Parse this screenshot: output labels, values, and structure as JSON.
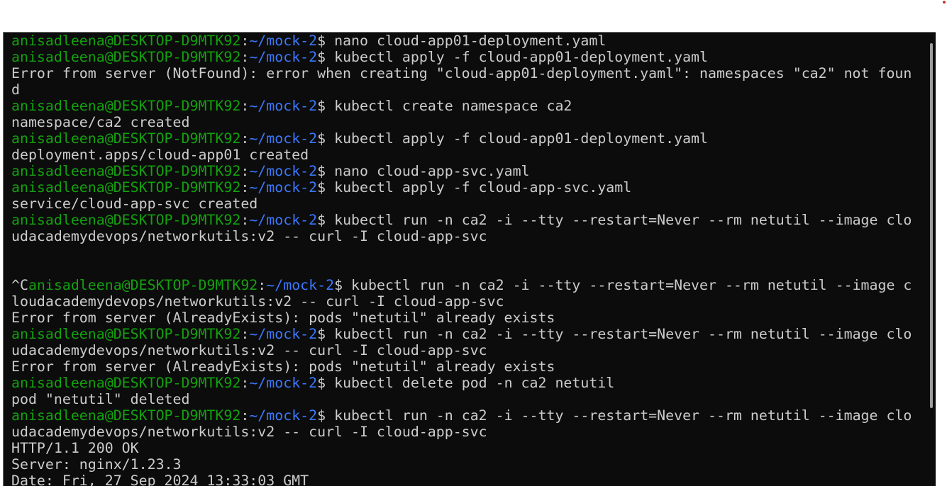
{
  "colors": {
    "background": "#0c0c0c",
    "text": "#cccccc",
    "user": "#13a10e",
    "path": "#3b78ff"
  },
  "terminal": {
    "lines": [
      {
        "parts": [
          {
            "cls": "user",
            "t": "anisadleena@DESKTOP-D9MTK92"
          },
          {
            "cls": "",
            "t": ":"
          },
          {
            "cls": "path",
            "t": "~/mock-2"
          },
          {
            "cls": "",
            "t": "$ nano cloud-app01-deployment.yaml"
          }
        ]
      },
      {
        "parts": [
          {
            "cls": "user",
            "t": "anisadleena@DESKTOP-D9MTK92"
          },
          {
            "cls": "",
            "t": ":"
          },
          {
            "cls": "path",
            "t": "~/mock-2"
          },
          {
            "cls": "",
            "t": "$ kubectl apply -f cloud-app01-deployment.yaml"
          }
        ]
      },
      {
        "parts": [
          {
            "cls": "",
            "t": "Error from server (NotFound): error when creating \"cloud-app01-deployment.yaml\": namespaces \"ca2\" not foun"
          }
        ]
      },
      {
        "parts": [
          {
            "cls": "",
            "t": "d"
          }
        ]
      },
      {
        "parts": [
          {
            "cls": "user",
            "t": "anisadleena@DESKTOP-D9MTK92"
          },
          {
            "cls": "",
            "t": ":"
          },
          {
            "cls": "path",
            "t": "~/mock-2"
          },
          {
            "cls": "",
            "t": "$ kubectl create namespace ca2"
          }
        ]
      },
      {
        "parts": [
          {
            "cls": "",
            "t": "namespace/ca2 created"
          }
        ]
      },
      {
        "parts": [
          {
            "cls": "user",
            "t": "anisadleena@DESKTOP-D9MTK92"
          },
          {
            "cls": "",
            "t": ":"
          },
          {
            "cls": "path",
            "t": "~/mock-2"
          },
          {
            "cls": "",
            "t": "$ kubectl apply -f cloud-app01-deployment.yaml"
          }
        ]
      },
      {
        "parts": [
          {
            "cls": "",
            "t": "deployment.apps/cloud-app01 created"
          }
        ]
      },
      {
        "parts": [
          {
            "cls": "user",
            "t": "anisadleena@DESKTOP-D9MTK92"
          },
          {
            "cls": "",
            "t": ":"
          },
          {
            "cls": "path",
            "t": "~/mock-2"
          },
          {
            "cls": "",
            "t": "$ nano cloud-app-svc.yaml"
          }
        ]
      },
      {
        "parts": [
          {
            "cls": "user",
            "t": "anisadleena@DESKTOP-D9MTK92"
          },
          {
            "cls": "",
            "t": ":"
          },
          {
            "cls": "path",
            "t": "~/mock-2"
          },
          {
            "cls": "",
            "t": "$ kubectl apply -f cloud-app-svc.yaml"
          }
        ]
      },
      {
        "parts": [
          {
            "cls": "",
            "t": "service/cloud-app-svc created"
          }
        ]
      },
      {
        "parts": [
          {
            "cls": "user",
            "t": "anisadleena@DESKTOP-D9MTK92"
          },
          {
            "cls": "",
            "t": ":"
          },
          {
            "cls": "path",
            "t": "~/mock-2"
          },
          {
            "cls": "",
            "t": "$ kubectl run -n ca2 -i --tty --restart=Never --rm netutil --image clo"
          }
        ]
      },
      {
        "parts": [
          {
            "cls": "",
            "t": "udacademydevops/networkutils:v2 -- curl -I cloud-app-svc"
          }
        ]
      },
      {
        "parts": [
          {
            "cls": "",
            "t": ""
          }
        ]
      },
      {
        "parts": [
          {
            "cls": "",
            "t": ""
          }
        ]
      },
      {
        "parts": [
          {
            "cls": "",
            "t": "^C"
          },
          {
            "cls": "user",
            "t": "anisadleena@DESKTOP-D9MTK92"
          },
          {
            "cls": "",
            "t": ":"
          },
          {
            "cls": "path",
            "t": "~/mock-2"
          },
          {
            "cls": "",
            "t": "$ kubectl run -n ca2 -i --tty --restart=Never --rm netutil --image c"
          }
        ]
      },
      {
        "parts": [
          {
            "cls": "",
            "t": "loudacademydevops/networkutils:v2 -- curl -I cloud-app-svc"
          }
        ]
      },
      {
        "parts": [
          {
            "cls": "",
            "t": "Error from server (AlreadyExists): pods \"netutil\" already exists"
          }
        ]
      },
      {
        "parts": [
          {
            "cls": "user",
            "t": "anisadleena@DESKTOP-D9MTK92"
          },
          {
            "cls": "",
            "t": ":"
          },
          {
            "cls": "path",
            "t": "~/mock-2"
          },
          {
            "cls": "",
            "t": "$ kubectl run -n ca2 -i --tty --restart=Never --rm netutil --image clo"
          }
        ]
      },
      {
        "parts": [
          {
            "cls": "",
            "t": "udacademydevops/networkutils:v2 -- curl -I cloud-app-svc"
          }
        ]
      },
      {
        "parts": [
          {
            "cls": "",
            "t": "Error from server (AlreadyExists): pods \"netutil\" already exists"
          }
        ]
      },
      {
        "parts": [
          {
            "cls": "user",
            "t": "anisadleena@DESKTOP-D9MTK92"
          },
          {
            "cls": "",
            "t": ":"
          },
          {
            "cls": "path",
            "t": "~/mock-2"
          },
          {
            "cls": "",
            "t": "$ kubectl delete pod -n ca2 netutil"
          }
        ]
      },
      {
        "parts": [
          {
            "cls": "",
            "t": "pod \"netutil\" deleted"
          }
        ]
      },
      {
        "parts": [
          {
            "cls": "user",
            "t": "anisadleena@DESKTOP-D9MTK92"
          },
          {
            "cls": "",
            "t": ":"
          },
          {
            "cls": "path",
            "t": "~/mock-2"
          },
          {
            "cls": "",
            "t": "$ kubectl run -n ca2 -i --tty --restart=Never --rm netutil --image clo"
          }
        ]
      },
      {
        "parts": [
          {
            "cls": "",
            "t": "udacademydevops/networkutils:v2 -- curl -I cloud-app-svc"
          }
        ]
      },
      {
        "parts": [
          {
            "cls": "",
            "t": "HTTP/1.1 200 OK"
          }
        ]
      },
      {
        "parts": [
          {
            "cls": "",
            "t": "Server: nginx/1.23.3"
          }
        ]
      },
      {
        "parts": [
          {
            "cls": "",
            "t": "Date: Fri, 27 Sep 2024 13:33:03 GMT"
          }
        ]
      }
    ]
  }
}
